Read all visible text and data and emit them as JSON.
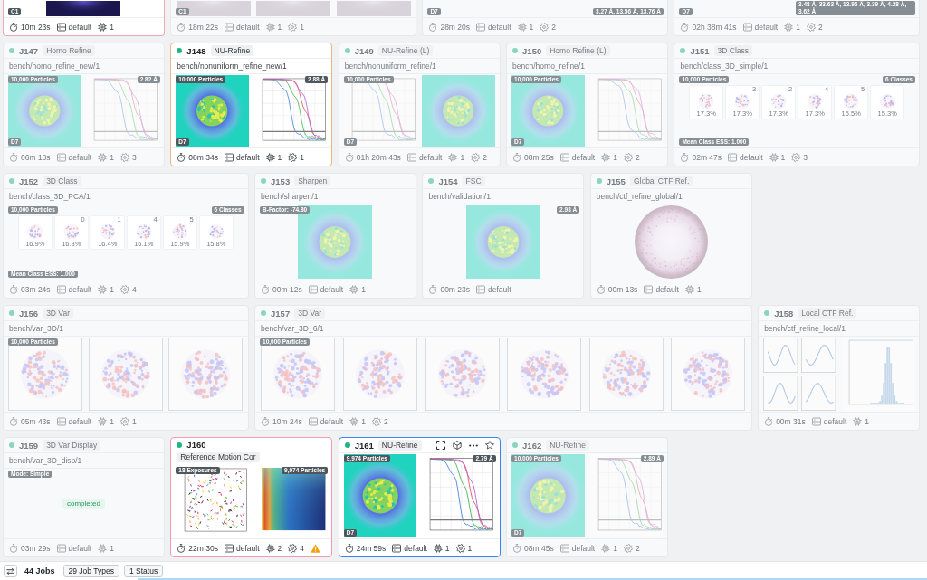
{
  "jobs": [
    {
      "kind": "partial",
      "dimmed": false,
      "selected": false,
      "warning": false,
      "color": "#f4a6b7",
      "preview": {
        "panels": [
          {
            "kind": "micrograph"
          }
        ],
        "badges": {
          "bottom_left": "C1"
        }
      },
      "footer": {
        "elapsed": "10m 23s",
        "lane": "default",
        "cpu": "1"
      }
    },
    {
      "kind": "partial",
      "dimmed": true,
      "selected": false,
      "warning": false,
      "preview": {
        "panels": [
          {
            "kind": "slice"
          },
          {
            "kind": "slice"
          },
          {
            "kind": "slice"
          }
        ],
        "badges": {
          "bottom_left": "C1"
        }
      },
      "footer": {
        "elapsed": "18m 22s",
        "lane": "default",
        "cpu": "1",
        "gear": "1"
      }
    },
    {
      "kind": "partial",
      "dimmed": true,
      "selected": false,
      "warning": false,
      "preview": {
        "badges": {
          "bottom_left": "D7",
          "bottom_right": "3.27 Å, 13.56 Å, 13.76 Å"
        }
      },
      "footer": {
        "elapsed": "28m 20s",
        "lane": "default",
        "cpu": "1",
        "gear": "2"
      }
    },
    {
      "kind": "partial",
      "dimmed": true,
      "selected": false,
      "warning": false,
      "preview": {
        "badges": {
          "bottom_left": "D7",
          "bottom_right": "3.48 Å, 33.63 Å, 13.96 Å, 3.39 Å, 4.28 Å, 3.62 Å"
        }
      },
      "footer": {
        "elapsed": "02h 38m 41s",
        "lane": "default",
        "cpu": "1",
        "gear": "2"
      }
    },
    {
      "kind": "job",
      "id": "J147",
      "type": "Homo Refine",
      "path": "bench/homo_refine_new/1",
      "dimmed": true,
      "selected": false,
      "warning": false,
      "preview": {
        "panels": [
          {
            "kind": "map"
          },
          {
            "kind": "fsc"
          }
        ],
        "badges": {
          "top_left": "10,000 Particles",
          "top_right": "2.82 Å",
          "bottom_left": "D7"
        }
      },
      "footer": {
        "elapsed": "06m 18s",
        "lane": "default",
        "cpu": "1",
        "gear": "3"
      }
    },
    {
      "kind": "job",
      "id": "J148",
      "type": "NU-Refine",
      "path": "bench/nonuniform_refine_new/1",
      "dimmed": false,
      "selected": false,
      "warning": false,
      "color": "#f2b384",
      "preview": {
        "panels": [
          {
            "kind": "map"
          },
          {
            "kind": "fsc"
          }
        ],
        "badges": {
          "top_left": "10,000 Particles",
          "top_right": "2.88 Å",
          "bottom_left": "D7"
        }
      },
      "footer": {
        "elapsed": "08m 34s",
        "lane": "default",
        "cpu": "1",
        "gear": "1"
      }
    },
    {
      "kind": "job",
      "id": "J149",
      "type": "NU-Refine (L)",
      "path": "bench/nonuniform_refine/1",
      "dimmed": true,
      "selected": false,
      "warning": false,
      "preview": {
        "panels": [
          {
            "kind": "fsc"
          },
          {
            "kind": "map"
          }
        ],
        "badges": {
          "top_left": "10,000 Particles",
          "bottom_left": "D7"
        }
      },
      "footer": {
        "elapsed": "01h 20m 43s",
        "lane": "default",
        "cpu": "1",
        "gear": "2"
      }
    },
    {
      "kind": "job",
      "id": "J150",
      "type": "Homo Refine (L)",
      "path": "bench/homo_refine/1",
      "dimmed": true,
      "selected": false,
      "warning": false,
      "preview": {
        "panels": [
          {
            "kind": "map"
          },
          {
            "kind": "fsc"
          }
        ],
        "badges": {
          "top_left": "10,000 Particles",
          "bottom_left": "D7"
        }
      },
      "footer": {
        "elapsed": "08m 25s",
        "lane": "default",
        "cpu": "1",
        "gear": "2"
      }
    },
    {
      "kind": "job",
      "id": "J151",
      "type": "3D Class",
      "path": "bench/class_3D_simple/1",
      "dimmed": true,
      "selected": false,
      "warning": false,
      "preview": {
        "classes": [
          {
            "percent": "17.3%"
          },
          {
            "label": "3",
            "percent": "17.3%"
          },
          {
            "label": "2",
            "percent": "17.3%"
          },
          {
            "label": "4",
            "percent": "17.3%"
          },
          {
            "label": "5",
            "percent": "15.5%"
          },
          {
            "percent": "15.3%"
          }
        ],
        "badges": {
          "top_left": "10,000 Particles",
          "top_right": "6 Classes",
          "bottom_left": "Mean Class ESS: 1.000"
        }
      },
      "footer": {
        "elapsed": "02m 47s",
        "lane": "default",
        "cpu": "1",
        "gear": "3"
      }
    },
    {
      "kind": "job",
      "id": "J152",
      "type": "3D Class",
      "path": "bench/class_3D_PCA/1",
      "dimmed": true,
      "selected": false,
      "warning": false,
      "preview": {
        "classes": [
          {
            "percent": "16.9%"
          },
          {
            "label": "0",
            "percent": "16.8%"
          },
          {
            "label": "1",
            "percent": "16.4%"
          },
          {
            "label": "4",
            "percent": "16.1%"
          },
          {
            "label": "5",
            "percent": "15.9%"
          },
          {
            "percent": "15.8%"
          }
        ],
        "badges": {
          "top_left": "10,000 Particles",
          "top_right": "6 Classes",
          "bottom_left": "Mean Class ESS: 1.000"
        }
      },
      "footer": {
        "elapsed": "03m 24s",
        "lane": "default",
        "cpu": "1",
        "gear": "4"
      }
    },
    {
      "kind": "job",
      "id": "J153",
      "type": "Sharpen",
      "path": "bench/sharpen/1",
      "dimmed": true,
      "selected": false,
      "warning": false,
      "preview": {
        "panels": [
          {
            "kind": "map"
          }
        ],
        "badges": {
          "top_left": "B-Factor: -74.80"
        }
      },
      "footer": {
        "elapsed": "00m 12s",
        "lane": "default",
        "cpu": "1"
      }
    },
    {
      "kind": "job",
      "id": "J154",
      "type": "FSC",
      "path": "bench/validation/1",
      "dimmed": true,
      "selected": false,
      "warning": false,
      "preview": {
        "panels": [
          {
            "kind": "map"
          }
        ],
        "badges": {
          "top_right": "2.93 Å"
        }
      },
      "footer": {
        "elapsed": "00m 23s",
        "lane": "default"
      }
    },
    {
      "kind": "job",
      "id": "J155",
      "type": "Global CTF Ref.",
      "path": "bench/ctf_refine_global/1",
      "dimmed": true,
      "selected": false,
      "warning": false,
      "preview": {
        "panels": [
          {
            "kind": "ring"
          }
        ]
      },
      "footer": {
        "elapsed": "00m 13s",
        "lane": "default",
        "cpu": "1"
      }
    },
    {
      "kind": "job",
      "id": "J156",
      "type": "3D Var",
      "path": "bench/var_3D/1",
      "dimmed": true,
      "selected": false,
      "warning": false,
      "preview": {
        "panels": [
          {
            "kind": "volume"
          },
          {
            "kind": "volume"
          },
          {
            "kind": "volume"
          }
        ],
        "badges": {
          "top_left": "10,000 Particles"
        }
      },
      "footer": {
        "elapsed": "05m 43s",
        "lane": "default",
        "cpu": "1",
        "gear": "1"
      }
    },
    {
      "kind": "job",
      "id": "J157",
      "type": "3D Var",
      "path": "bench/var_3D_6/1",
      "dimmed": true,
      "selected": false,
      "warning": false,
      "preview": {
        "panels": [
          {
            "kind": "volume"
          },
          {
            "kind": "volume"
          },
          {
            "kind": "volume"
          },
          {
            "kind": "volume"
          },
          {
            "kind": "volume"
          },
          {
            "kind": "volume"
          }
        ],
        "badges": {
          "top_left": "10,000 Particles"
        }
      },
      "footer": {
        "elapsed": "10m 24s",
        "lane": "default",
        "cpu": "1",
        "gear": "2"
      }
    },
    {
      "kind": "job",
      "id": "J158",
      "type": "Local CTF Ref.",
      "path": "bench/ctf_refine_local/1",
      "dimmed": true,
      "selected": false,
      "warning": false,
      "preview": {
        "panels": [
          {
            "kind": "ctf_grid"
          },
          {
            "kind": "histogram"
          }
        ]
      },
      "footer": {
        "elapsed": "00m 31s",
        "lane": "default",
        "cpu": "1"
      }
    },
    {
      "kind": "job",
      "id": "J159",
      "type": "3D Var Display",
      "path": "bench/var_3D_disp/1",
      "dimmed": true,
      "selected": false,
      "warning": false,
      "preview": {
        "status": "completed",
        "badges": {
          "top_left": "Mode: Simple"
        }
      },
      "footer": {
        "elapsed": "03m 29s",
        "lane": "default",
        "cpu": "1"
      }
    },
    {
      "kind": "titled",
      "id": "J160",
      "type": "Reference Motion Cor",
      "dimmed": false,
      "selected": false,
      "warning": true,
      "color": "#f29aae",
      "preview": {
        "panels": [
          {
            "kind": "trajectories"
          },
          {
            "kind": "heatmap"
          }
        ],
        "badges": {
          "top_left": "18 Exposures",
          "top_right": "9,974 Particles"
        }
      },
      "footer": {
        "elapsed": "22m 30s",
        "lane": "default",
        "cpu": "2",
        "gear": "4"
      }
    },
    {
      "kind": "job",
      "id": "J161",
      "type": "NU-Refine",
      "dimmed": false,
      "selected": true,
      "warning": false,
      "toolbar": {
        "starred": false
      },
      "preview": {
        "panels": [
          {
            "kind": "map"
          },
          {
            "kind": "fsc"
          }
        ],
        "badges": {
          "top_left": "9,974 Particles",
          "top_right": "2.79 Å",
          "bottom_left": "D7"
        }
      },
      "footer": {
        "elapsed": "24m 59s",
        "lane": "default",
        "cpu": "1",
        "gear": "1"
      }
    },
    {
      "kind": "job",
      "id": "J162",
      "type": "NU-Refine",
      "dimmed": true,
      "selected": false,
      "warning": false,
      "preview": {
        "panels": [
          {
            "kind": "map"
          },
          {
            "kind": "fsc"
          }
        ],
        "badges": {
          "top_left": "10,000 Particles",
          "top_right": "2.89 Å",
          "bottom_left": "D7"
        }
      },
      "footer": {
        "elapsed": "08m 45s",
        "lane": "default",
        "cpu": "1",
        "gear": "2"
      }
    }
  ],
  "status_bar": {
    "job_count": "44 Jobs",
    "filters": [
      "29 Job Types",
      "1 Status"
    ]
  }
}
